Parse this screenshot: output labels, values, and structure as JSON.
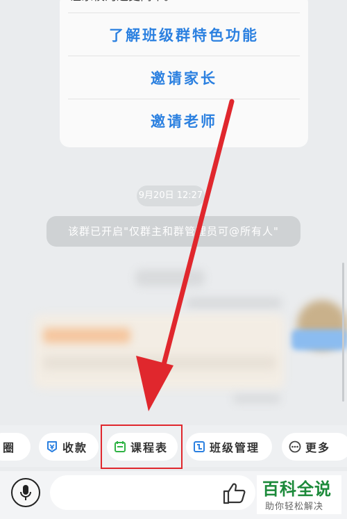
{
  "card": {
    "top_text": "让家校沟通更简单。",
    "links": [
      "了解班级群特色功能",
      "邀请家长",
      "邀请老师"
    ]
  },
  "chat": {
    "timestamp": "9月20日 12:27",
    "system_notice": "该群已开启\"仅群主和群管理员可@所有人\""
  },
  "toolbar": {
    "items": [
      "圈",
      "收款",
      "课程表",
      "班级管理",
      "更多"
    ]
  },
  "input": {
    "placeholder": ""
  },
  "watermark": {
    "title": "百科全说",
    "subtitle": "助你轻松解决"
  },
  "colors": {
    "link_blue": "#2b80e0",
    "highlight_red": "#e0272d",
    "schedule_icon_green": "#2fb344",
    "icon_blue": "#2b80e0",
    "watermark_green": "#1c8a3a"
  }
}
